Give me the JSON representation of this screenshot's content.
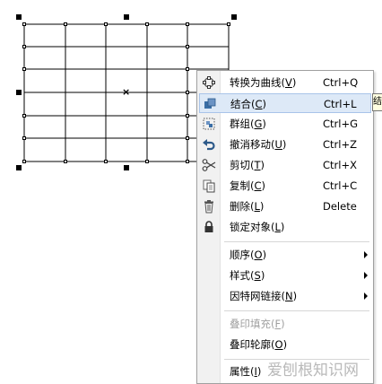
{
  "menu": {
    "items": [
      {
        "label": "转换为曲线",
        "key": "V",
        "shortcut": "Ctrl+Q",
        "icon": "convert-curve-icon"
      },
      {
        "label": "结合",
        "key": "C",
        "shortcut": "Ctrl+L",
        "icon": "combine-icon",
        "highlighted": true
      },
      {
        "label": "群组",
        "key": "G",
        "shortcut": "Ctrl+G",
        "icon": "group-icon"
      },
      {
        "label": "撤消移动",
        "key": "U",
        "shortcut": "Ctrl+Z",
        "icon": "undo-icon"
      },
      {
        "label": "剪切",
        "key": "T",
        "shortcut": "Ctrl+X",
        "icon": "scissors-icon"
      },
      {
        "label": "复制",
        "key": "C",
        "shortcut": "Ctrl+C",
        "icon": "copy-icon"
      },
      {
        "label": "删除",
        "key": "L",
        "shortcut": "Delete",
        "icon": "trash-icon"
      },
      {
        "label": "锁定对象",
        "key": "L",
        "shortcut": "",
        "icon": "lock-icon"
      },
      {
        "label": "顺序",
        "key": "O",
        "shortcut": "",
        "submenu": true
      },
      {
        "label": "样式",
        "key": "S",
        "shortcut": "",
        "submenu": true
      },
      {
        "label": "因特网链接",
        "key": "N",
        "shortcut": "",
        "submenu": true
      },
      {
        "label": "叠印填充",
        "key": "F",
        "shortcut": "",
        "disabled": true
      },
      {
        "label": "叠印轮廓",
        "key": "O",
        "shortcut": ""
      },
      {
        "label": "属性",
        "key": "I",
        "shortcut": ""
      }
    ]
  },
  "tooltip": {
    "text": "结"
  },
  "watermark": {
    "text": "爱刨根知识网"
  },
  "colors": {
    "highlight": "#dde9f7",
    "highlight_border": "#a9c4e9",
    "disabled": "#a0a0a0",
    "icon_column": "#f1f1f1"
  }
}
